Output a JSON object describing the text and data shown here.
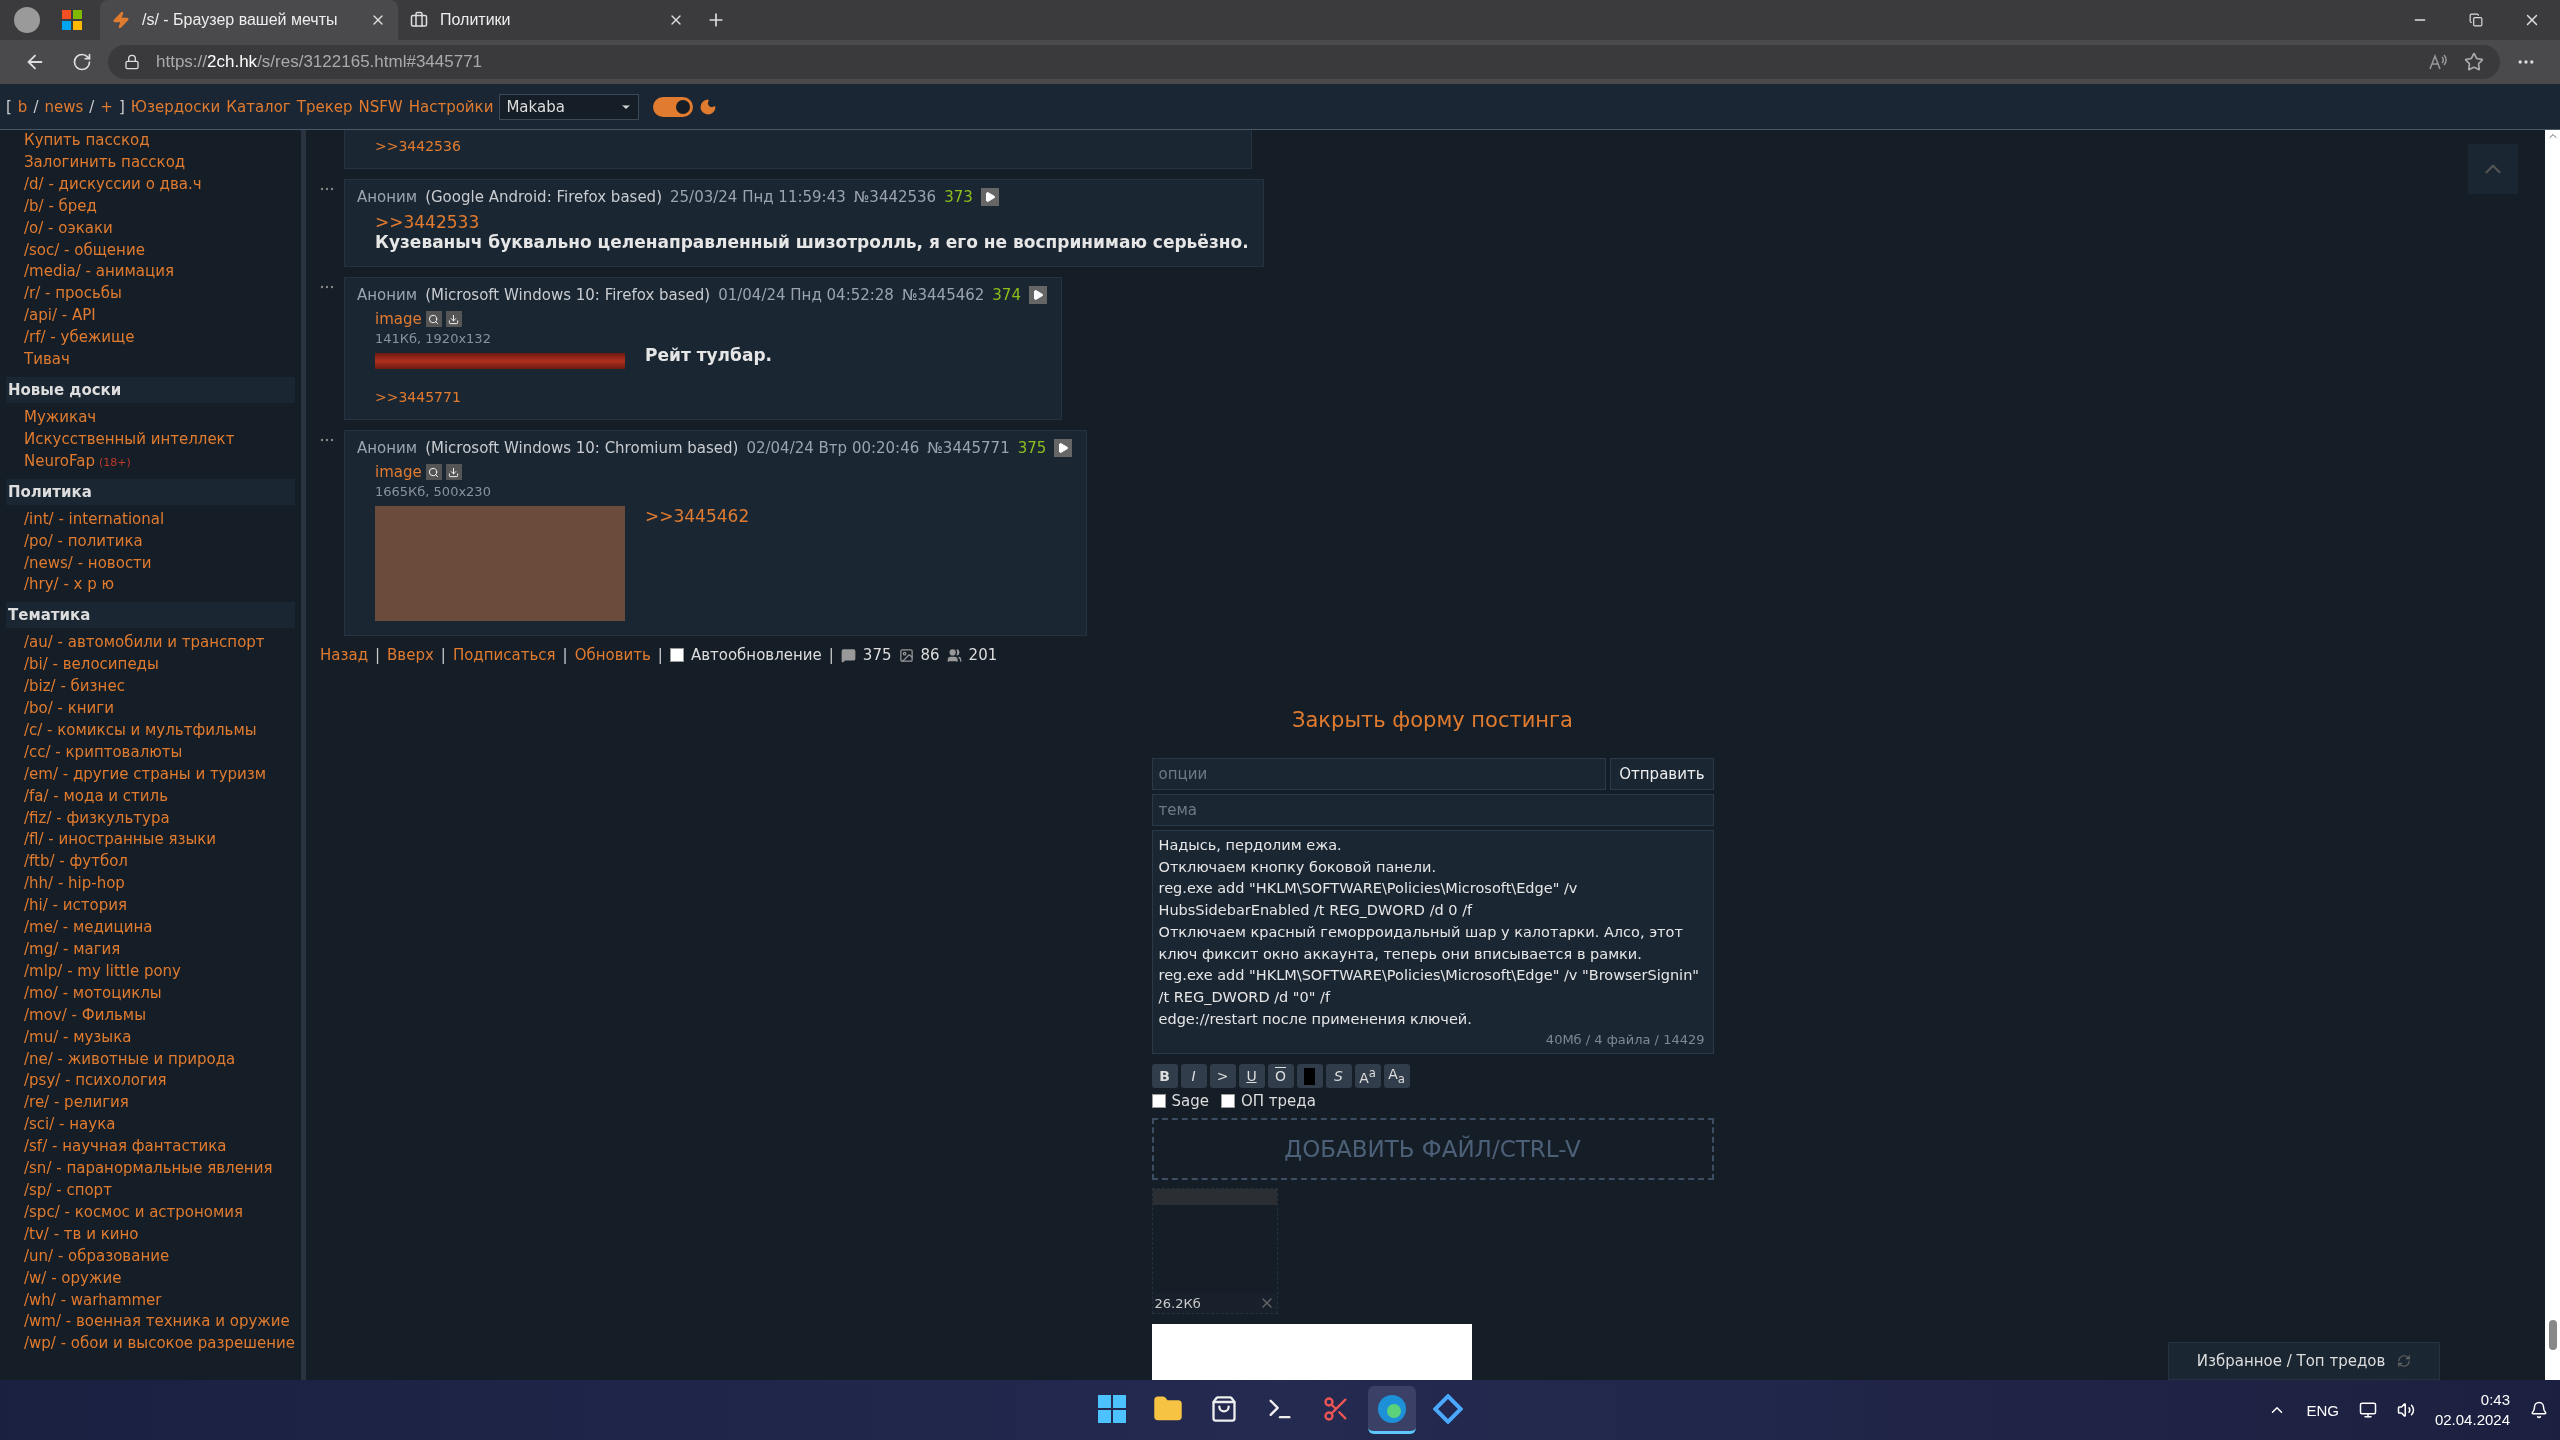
{
  "browser": {
    "tabs": [
      {
        "title": "/s/ - Браузер вашей мечты",
        "selected": true,
        "kind": "bolt"
      },
      {
        "title": "Политики",
        "selected": false,
        "kind": "case"
      }
    ],
    "url": {
      "scheme": "https://",
      "host": "2ch.hk",
      "path": "/s/res/3122165.html#3445771"
    }
  },
  "site_nav": {
    "brackets": [
      "[",
      "]"
    ],
    "separator": "/",
    "boards": [
      "b",
      "news",
      "+"
    ],
    "links": [
      "Юзердоски",
      "Каталог",
      "Трекер",
      "NSFW",
      "Настройки"
    ],
    "style_select": "Makaba",
    "dark_mode": true
  },
  "sidebar": {
    "items": [
      {
        "label": "Купить пасскод"
      },
      {
        "label": "Залогинить пасскод"
      },
      {
        "label": "/d/ - дискуссии о два.ч"
      },
      {
        "label": "/b/ - бред"
      },
      {
        "label": "/o/ - оэкаки"
      },
      {
        "label": "/soc/ - общение"
      },
      {
        "label": "/media/ - анимация"
      },
      {
        "label": "/r/ - просьбы"
      },
      {
        "label": "/api/ - API"
      },
      {
        "label": "/rf/ - убежище"
      },
      {
        "label": "Тивач"
      }
    ],
    "sections": [
      {
        "title": "Новые доски",
        "items": [
          {
            "label": "Мужикач"
          },
          {
            "label": "Искусственный интеллект"
          },
          {
            "label": "NeuroFap",
            "badge": "(18+)"
          }
        ]
      },
      {
        "title": "Политика",
        "items": [
          {
            "label": "/int/ - international"
          },
          {
            "label": "/po/ - политика"
          },
          {
            "label": "/news/ - новости"
          },
          {
            "label": "/hry/ - х р ю"
          }
        ]
      },
      {
        "title": "Тематика",
        "items": [
          {
            "label": "/au/ - автомобили и транспорт"
          },
          {
            "label": "/bi/ - велосипеды"
          },
          {
            "label": "/biz/ - бизнес"
          },
          {
            "label": "/bo/ - книги"
          },
          {
            "label": "/c/ - комиксы и мультфильмы"
          },
          {
            "label": "/cc/ - криптовалюты"
          },
          {
            "label": "/em/ - другие страны и туризм"
          },
          {
            "label": "/fa/ - мода и стиль"
          },
          {
            "label": "/fiz/ - физкультура"
          },
          {
            "label": "/fl/ - иностранные языки"
          },
          {
            "label": "/ftb/ - футбол"
          },
          {
            "label": "/hh/ - hip-hop"
          },
          {
            "label": "/hi/ - история"
          },
          {
            "label": "/me/ - медицина"
          },
          {
            "label": "/mg/ - магия"
          },
          {
            "label": "/mlp/ - my little pony"
          },
          {
            "label": "/mo/ - мотоциклы"
          },
          {
            "label": "/mov/ - Фильмы"
          },
          {
            "label": "/mu/ - музыка"
          },
          {
            "label": "/ne/ - животные и природа"
          },
          {
            "label": "/psy/ - психология"
          },
          {
            "label": "/re/ - религия"
          },
          {
            "label": "/sci/ - наука"
          },
          {
            "label": "/sf/ - научная фантастика"
          },
          {
            "label": "/sn/ - паранормальные явления"
          },
          {
            "label": "/sp/ - спорт"
          },
          {
            "label": "/spc/ - космос и астрономия"
          },
          {
            "label": "/tv/ - тв и кино"
          },
          {
            "label": "/un/ - образование"
          },
          {
            "label": "/w/ - оружие"
          },
          {
            "label": "/wh/ - warhammer"
          },
          {
            "label": "/wm/ - военная техника и оружие"
          },
          {
            "label": "/wp/ - обои и высокое разрешение"
          }
        ]
      }
    ]
  },
  "posts": [
    {
      "backlinks": [
        ">>3442536"
      ]
    },
    {
      "author": "Аноним",
      "os": "(Google Android: Firefox based)",
      "date": "25/03/24 Пнд 11:59:43",
      "number": "№3442536",
      "count": "373",
      "body": [
        {
          "kind": "link",
          "text": ">>3442533"
        },
        {
          "kind": "text",
          "text": "Кузеваныч буквально целенаправленный шизотролль, я его не воспринимаю серьёзно."
        }
      ]
    },
    {
      "author": "Аноним",
      "os": "(Microsoft Windows 10: Firefox based)",
      "date": "01/04/24 Пнд 04:52:28",
      "number": "№3445462",
      "count": "374",
      "file": {
        "name": "image",
        "info": "141Кб, 1920x132",
        "kind": "strip"
      },
      "body": [
        {
          "kind": "text",
          "text": "Рейт тулбар."
        }
      ],
      "backlinks": [
        ">>3445771"
      ]
    },
    {
      "author": "Аноним",
      "os": "(Microsoft Windows 10: Chromium based)",
      "date": "02/04/24 Втр 00:20:46",
      "number": "№3445771",
      "count": "375",
      "file": {
        "name": "image",
        "info": "1665Кб, 500x230",
        "kind": "photo"
      },
      "body": [
        {
          "kind": "link",
          "text": ">>3445462"
        }
      ]
    }
  ],
  "thread_footer": {
    "separator": "|",
    "links": [
      "Назад",
      "Вверх",
      "Подписаться",
      "Обновить"
    ],
    "autoupdate": {
      "label": "Автообновление",
      "checked": false
    },
    "stats": {
      "posts": "375",
      "files": "86",
      "posters": "201"
    }
  },
  "post_form": {
    "close_link": "Закрыть форму постинга",
    "options_placeholder": "опции",
    "submit": "Отправить",
    "subject_placeholder": "тема",
    "message": "Надысь, пердолим ежа.\nОтключаем кнопку боковой панели.\nreg.exe add \"HKLM\\SOFTWARE\\Policies\\Microsoft\\Edge\" /v HubsSidebarEnabled /t REG_DWORD /d 0 /f\nОтключаем красный геморроидальный шар у калотарки. Алсо, этот ключ фиксит окно аккаунта, теперь они вписывается в рамки.\nreg.exe add \"HKLM\\SOFTWARE\\Policies\\Microsoft\\Edge\" /v \"BrowserSignin\" /t REG_DWORD /d \"0\" /f\nedge://restart после применения ключей.",
    "limits": "40Мб / 4 файла / 14429",
    "format_buttons": [
      {
        "kind": "bold",
        "label": "B"
      },
      {
        "kind": "italic",
        "label": "I"
      },
      {
        "kind": "quote",
        "label": ">"
      },
      {
        "kind": "underline",
        "label": "U"
      },
      {
        "kind": "overline",
        "label": "O"
      },
      {
        "kind": "spoiler"
      },
      {
        "kind": "strike",
        "label": "S"
      },
      {
        "kind": "plain",
        "label": "A$^{a}$"
      },
      {
        "kind": "plain",
        "label": "A$_{a}$"
      }
    ],
    "checkboxes": [
      {
        "label": "Sage",
        "checked": false
      },
      {
        "label": "ОП треда",
        "checked": false
      }
    ],
    "dropzone": "ДОБАВИТЬ ФАЙЛ/CTRL-V",
    "attachment": {
      "size": "26.2Кб"
    }
  },
  "favorites_panel": "Избранное / Топ тредов",
  "taskbar": {
    "apps": [
      {
        "kind": "start",
        "active": false
      },
      {
        "kind": "folder",
        "active": false
      },
      {
        "kind": "store",
        "active": false
      },
      {
        "kind": "terminal",
        "active": false
      },
      {
        "kind": "snip",
        "active": false
      },
      {
        "kind": "edge",
        "active": true
      },
      {
        "kind": "tool",
        "active": false
      }
    ],
    "language": "ENG",
    "time": "0:43",
    "date": "02.04.2024"
  }
}
